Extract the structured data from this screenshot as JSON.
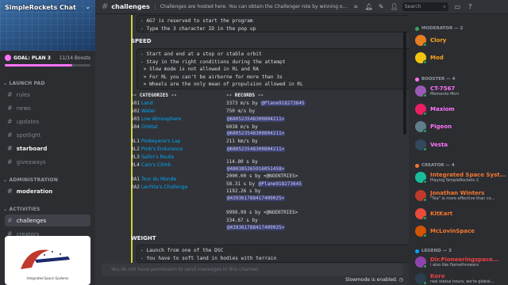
{
  "server": {
    "name": "SimpleRockets Chat",
    "goal_label": "GOAL: PLAN 3",
    "goal_count": "11/14 Boosts",
    "goal_progress": 0.79,
    "logo_caption": "Integrated Space Systems"
  },
  "sidebar": {
    "sections": [
      {
        "label": "LAUNCH PAD"
      },
      {
        "label": "ADMINISTRATION"
      },
      {
        "label": "ACTIVITIES"
      }
    ],
    "channels": [
      {
        "label": "rules"
      },
      {
        "label": "news"
      },
      {
        "label": "updates"
      },
      {
        "label": "spotlight"
      },
      {
        "label": "starboard"
      },
      {
        "label": "giveaways"
      },
      {
        "label": "moderation"
      },
      {
        "label": "challenges"
      },
      {
        "label": "creators"
      }
    ]
  },
  "header": {
    "channel": "challenges",
    "topic": "Challenges are hosted here. You can obtain the Challenger role by winning o...",
    "search_placeholder": "Search"
  },
  "chat": {
    "intro_lines": "- AG7 is reserved to start the program\n- Type the 3 character ID in the pop up",
    "speed_heading": "SPEED",
    "speed_rules": "- Start and end at a stop or stable orbit\n- Stay in the right conditions during the attempt\n > Slow mode is not allowed in RL and RA\n > For RL you can't be airborne for more than 3s\n > Wheels are the only mean of propulsion allowed in RL",
    "categories_header": "-- CATEGORIES --",
    "records_header": "-- RECORDS --",
    "categories": [
      {
        "code": "S01",
        "name": "Land"
      },
      {
        "code": "S02",
        "name": "Water"
      },
      {
        "code": "S03",
        "name": "Low Atmosphere"
      },
      {
        "code": "S04",
        "name": "Orbital"
      },
      {
        "code": "RL1",
        "name": "Probeyene's Lap"
      },
      {
        "code": "RL2",
        "name": "Prob's Endurance"
      },
      {
        "code": "RL3",
        "name": "Sailor's Route"
      },
      {
        "code": "RL4",
        "name": "Cain's Climb"
      },
      {
        "code": "RA1",
        "name": "Tour du Monde"
      },
      {
        "code": "RA2",
        "name": "Lechita's Challenge"
      }
    ],
    "records": [
      {
        "value": "3373  m/s by",
        "mention": "@Plane918273645"
      },
      {
        "value": " 750  m/s by",
        "mention": ""
      },
      {
        "value": "",
        "mention": "@680523548300804211>"
      },
      {
        "value": "6038  m/s by",
        "mention": ""
      },
      {
        "value": "",
        "mention": "@680523548300804211>"
      },
      {
        "value": " 211 km/s by",
        "mention": ""
      },
      {
        "value": "",
        "mention": "@680523548300804211>"
      },
      {
        "value": " 114.80 s by",
        "mention": ""
      },
      {
        "value": "",
        "mention": "@480385265916051458>"
      },
      {
        "value": "2000.00 s by <@NOENTRIES>",
        "mention": ""
      },
      {
        "value": "  58.31 s by",
        "mention": "@Plane918273645"
      },
      {
        "value": "1192.26 s by",
        "mention": ""
      },
      {
        "value": "",
        "mention": "@439361788417409025>"
      },
      {
        "value": "9999.99 s by <@NOENTRIES>",
        "mention": ""
      },
      {
        "value": " 334.67 s by",
        "mention": ""
      },
      {
        "value": "",
        "mention": "@439361788417409025>"
      }
    ],
    "weight_heading": "WEIGHT",
    "weight_rules": "- Launch from one of the DSC\n- You have to soft land in bodies with terrain",
    "input_placeholder": "You do not have permission to send messages in this channel.",
    "slowmode_text": "Slowmode is enabled."
  },
  "members": {
    "roles": [
      {
        "label": "MODERATOR — 2",
        "color": "#3ba55c"
      },
      {
        "label": "BOOSTER — 4",
        "color": "#ff73fa"
      },
      {
        "label": "CREATOR — 4",
        "color": "#f57731"
      },
      {
        "label": "LEGEND — 3",
        "color": "#00a8fc"
      }
    ],
    "list": [
      {
        "name": "Clory",
        "status": "",
        "color": "#faa61a",
        "avatar": "#e67e22"
      },
      {
        "name": "Mod",
        "status": "",
        "color": "#faa61a",
        "avatar": "#f1c40f"
      },
      {
        "name": "CT-7567",
        "status": "Memento Mori",
        "color": "#ff73fa",
        "avatar": "#9b59b6"
      },
      {
        "name": "Maxiom",
        "status": "",
        "color": "#ff73fa",
        "avatar": "#e91e63"
      },
      {
        "name": "Pigeon",
        "status": "",
        "color": "#ff73fa",
        "avatar": "#607d8b"
      },
      {
        "name": "Vesta",
        "status": "",
        "color": "#ff73fa",
        "avatar": "#34495e"
      },
      {
        "name": "Integrated Space Syst...",
        "status": "Playing SimpleRockets 2",
        "color": "#f57731",
        "avatar": "#1abc9c"
      },
      {
        "name": "Jonathan Winters",
        "status": "\"Tea\" is more effective than co...",
        "color": "#f57731",
        "avatar": "#c0392b"
      },
      {
        "name": "KitKart",
        "status": "",
        "color": "#f57731",
        "avatar": "#e74c3c"
      },
      {
        "name": "McLovinSpace",
        "status": "",
        "color": "#f57731",
        "avatar": "#d35400"
      },
      {
        "name": "Dir.Pioneeringspace...",
        "status": "i also like flamethrowers",
        "color": "#ed4245",
        "avatar": "#8e44ad"
      },
      {
        "name": "Koro",
        "status": "real status hours, we're global...",
        "color": "#ed4245",
        "avatar": "#2c3e50"
      }
    ]
  },
  "colors": {
    "accent": "#5865f2",
    "link": "#00a8fc",
    "quote": "#d4d434"
  }
}
